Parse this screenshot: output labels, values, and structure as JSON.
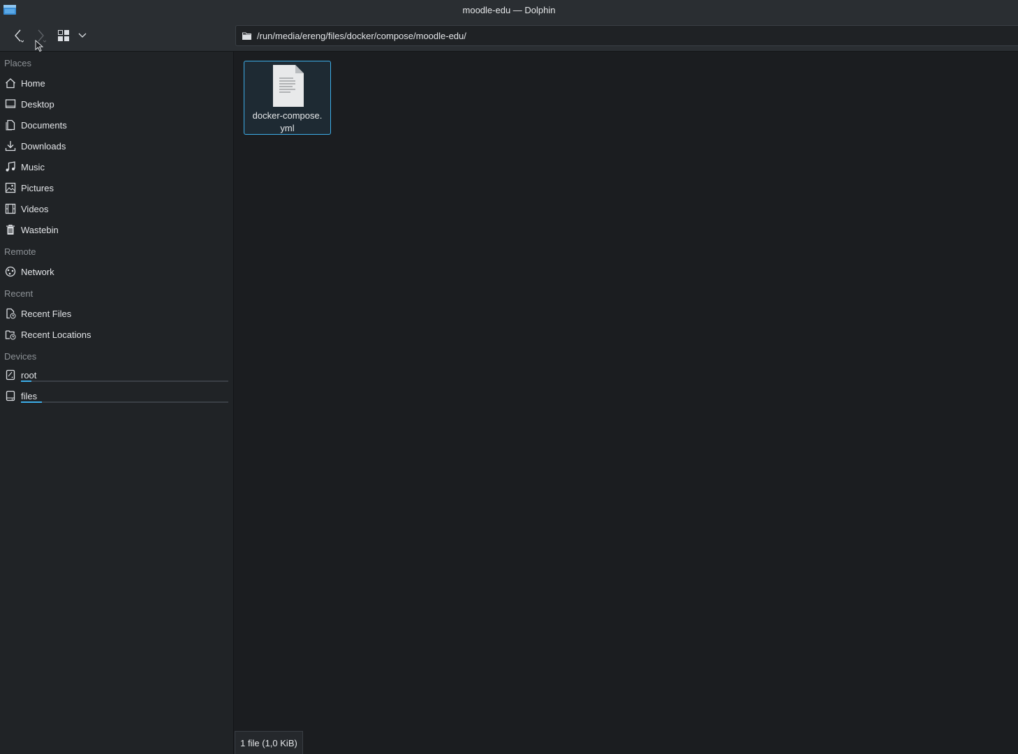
{
  "window": {
    "title": "moodle-edu — Dolphin"
  },
  "toolbar": {
    "back_icon": "chevron-left-icon",
    "forward_icon": "chevron-right-icon",
    "view_mode_icon": "view-icons-icon",
    "view_menu_icon": "chevron-down-icon"
  },
  "location": {
    "path": "/run/media/ereng/files/docker/compose/moodle-edu/"
  },
  "sidebar": {
    "places_header": "Places",
    "places": [
      {
        "label": "Home",
        "icon": "home-icon"
      },
      {
        "label": "Desktop",
        "icon": "desktop-icon"
      },
      {
        "label": "Documents",
        "icon": "documents-icon"
      },
      {
        "label": "Downloads",
        "icon": "downloads-icon"
      },
      {
        "label": "Music",
        "icon": "music-icon"
      },
      {
        "label": "Pictures",
        "icon": "pictures-icon"
      },
      {
        "label": "Videos",
        "icon": "videos-icon"
      },
      {
        "label": "Wastebin",
        "icon": "trash-icon"
      }
    ],
    "remote_header": "Remote",
    "remote": [
      {
        "label": "Network",
        "icon": "network-icon"
      }
    ],
    "recent_header": "Recent",
    "recent": [
      {
        "label": "Recent Files",
        "icon": "recent-files-icon"
      },
      {
        "label": "Recent Locations",
        "icon": "recent-locations-icon"
      }
    ],
    "devices_header": "Devices",
    "devices": [
      {
        "label": "root",
        "icon": "drive-icon",
        "usage_fraction": 0.05
      },
      {
        "label": "files",
        "icon": "drive-icon",
        "usage_fraction": 0.1
      }
    ]
  },
  "files": [
    {
      "name_line1": "docker-compose.",
      "name_line2": "yml",
      "icon": "text-file-icon"
    }
  ],
  "status": {
    "text": "1 file (1,0 KiB)"
  },
  "colors": {
    "accent": "#3daee9",
    "background": "#1b1d20",
    "sidebar": "#202326",
    "toolbar": "#2a2e32"
  }
}
